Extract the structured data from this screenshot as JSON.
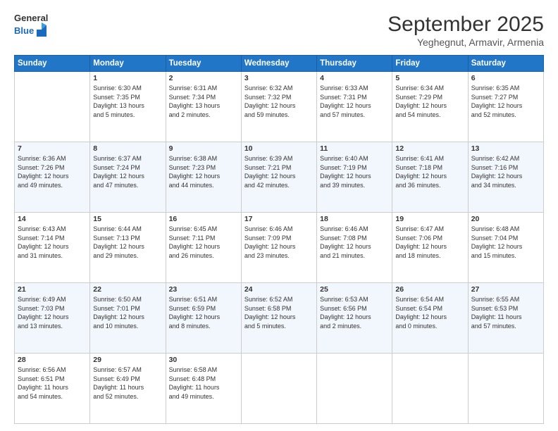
{
  "logo": {
    "general": "General",
    "blue": "Blue"
  },
  "title": "September 2025",
  "subtitle": "Yeghegnut, Armavir, Armenia",
  "days": [
    "Sunday",
    "Monday",
    "Tuesday",
    "Wednesday",
    "Thursday",
    "Friday",
    "Saturday"
  ],
  "weeks": [
    [
      {
        "num": "",
        "lines": []
      },
      {
        "num": "1",
        "lines": [
          "Sunrise: 6:30 AM",
          "Sunset: 7:35 PM",
          "Daylight: 13 hours",
          "and 5 minutes."
        ]
      },
      {
        "num": "2",
        "lines": [
          "Sunrise: 6:31 AM",
          "Sunset: 7:34 PM",
          "Daylight: 13 hours",
          "and 2 minutes."
        ]
      },
      {
        "num": "3",
        "lines": [
          "Sunrise: 6:32 AM",
          "Sunset: 7:32 PM",
          "Daylight: 12 hours",
          "and 59 minutes."
        ]
      },
      {
        "num": "4",
        "lines": [
          "Sunrise: 6:33 AM",
          "Sunset: 7:31 PM",
          "Daylight: 12 hours",
          "and 57 minutes."
        ]
      },
      {
        "num": "5",
        "lines": [
          "Sunrise: 6:34 AM",
          "Sunset: 7:29 PM",
          "Daylight: 12 hours",
          "and 54 minutes."
        ]
      },
      {
        "num": "6",
        "lines": [
          "Sunrise: 6:35 AM",
          "Sunset: 7:27 PM",
          "Daylight: 12 hours",
          "and 52 minutes."
        ]
      }
    ],
    [
      {
        "num": "7",
        "lines": [
          "Sunrise: 6:36 AM",
          "Sunset: 7:26 PM",
          "Daylight: 12 hours",
          "and 49 minutes."
        ]
      },
      {
        "num": "8",
        "lines": [
          "Sunrise: 6:37 AM",
          "Sunset: 7:24 PM",
          "Daylight: 12 hours",
          "and 47 minutes."
        ]
      },
      {
        "num": "9",
        "lines": [
          "Sunrise: 6:38 AM",
          "Sunset: 7:23 PM",
          "Daylight: 12 hours",
          "and 44 minutes."
        ]
      },
      {
        "num": "10",
        "lines": [
          "Sunrise: 6:39 AM",
          "Sunset: 7:21 PM",
          "Daylight: 12 hours",
          "and 42 minutes."
        ]
      },
      {
        "num": "11",
        "lines": [
          "Sunrise: 6:40 AM",
          "Sunset: 7:19 PM",
          "Daylight: 12 hours",
          "and 39 minutes."
        ]
      },
      {
        "num": "12",
        "lines": [
          "Sunrise: 6:41 AM",
          "Sunset: 7:18 PM",
          "Daylight: 12 hours",
          "and 36 minutes."
        ]
      },
      {
        "num": "13",
        "lines": [
          "Sunrise: 6:42 AM",
          "Sunset: 7:16 PM",
          "Daylight: 12 hours",
          "and 34 minutes."
        ]
      }
    ],
    [
      {
        "num": "14",
        "lines": [
          "Sunrise: 6:43 AM",
          "Sunset: 7:14 PM",
          "Daylight: 12 hours",
          "and 31 minutes."
        ]
      },
      {
        "num": "15",
        "lines": [
          "Sunrise: 6:44 AM",
          "Sunset: 7:13 PM",
          "Daylight: 12 hours",
          "and 29 minutes."
        ]
      },
      {
        "num": "16",
        "lines": [
          "Sunrise: 6:45 AM",
          "Sunset: 7:11 PM",
          "Daylight: 12 hours",
          "and 26 minutes."
        ]
      },
      {
        "num": "17",
        "lines": [
          "Sunrise: 6:46 AM",
          "Sunset: 7:09 PM",
          "Daylight: 12 hours",
          "and 23 minutes."
        ]
      },
      {
        "num": "18",
        "lines": [
          "Sunrise: 6:46 AM",
          "Sunset: 7:08 PM",
          "Daylight: 12 hours",
          "and 21 minutes."
        ]
      },
      {
        "num": "19",
        "lines": [
          "Sunrise: 6:47 AM",
          "Sunset: 7:06 PM",
          "Daylight: 12 hours",
          "and 18 minutes."
        ]
      },
      {
        "num": "20",
        "lines": [
          "Sunrise: 6:48 AM",
          "Sunset: 7:04 PM",
          "Daylight: 12 hours",
          "and 15 minutes."
        ]
      }
    ],
    [
      {
        "num": "21",
        "lines": [
          "Sunrise: 6:49 AM",
          "Sunset: 7:03 PM",
          "Daylight: 12 hours",
          "and 13 minutes."
        ]
      },
      {
        "num": "22",
        "lines": [
          "Sunrise: 6:50 AM",
          "Sunset: 7:01 PM",
          "Daylight: 12 hours",
          "and 10 minutes."
        ]
      },
      {
        "num": "23",
        "lines": [
          "Sunrise: 6:51 AM",
          "Sunset: 6:59 PM",
          "Daylight: 12 hours",
          "and 8 minutes."
        ]
      },
      {
        "num": "24",
        "lines": [
          "Sunrise: 6:52 AM",
          "Sunset: 6:58 PM",
          "Daylight: 12 hours",
          "and 5 minutes."
        ]
      },
      {
        "num": "25",
        "lines": [
          "Sunrise: 6:53 AM",
          "Sunset: 6:56 PM",
          "Daylight: 12 hours",
          "and 2 minutes."
        ]
      },
      {
        "num": "26",
        "lines": [
          "Sunrise: 6:54 AM",
          "Sunset: 6:54 PM",
          "Daylight: 12 hours",
          "and 0 minutes."
        ]
      },
      {
        "num": "27",
        "lines": [
          "Sunrise: 6:55 AM",
          "Sunset: 6:53 PM",
          "Daylight: 11 hours",
          "and 57 minutes."
        ]
      }
    ],
    [
      {
        "num": "28",
        "lines": [
          "Sunrise: 6:56 AM",
          "Sunset: 6:51 PM",
          "Daylight: 11 hours",
          "and 54 minutes."
        ]
      },
      {
        "num": "29",
        "lines": [
          "Sunrise: 6:57 AM",
          "Sunset: 6:49 PM",
          "Daylight: 11 hours",
          "and 52 minutes."
        ]
      },
      {
        "num": "30",
        "lines": [
          "Sunrise: 6:58 AM",
          "Sunset: 6:48 PM",
          "Daylight: 11 hours",
          "and 49 minutes."
        ]
      },
      {
        "num": "",
        "lines": []
      },
      {
        "num": "",
        "lines": []
      },
      {
        "num": "",
        "lines": []
      },
      {
        "num": "",
        "lines": []
      }
    ]
  ]
}
